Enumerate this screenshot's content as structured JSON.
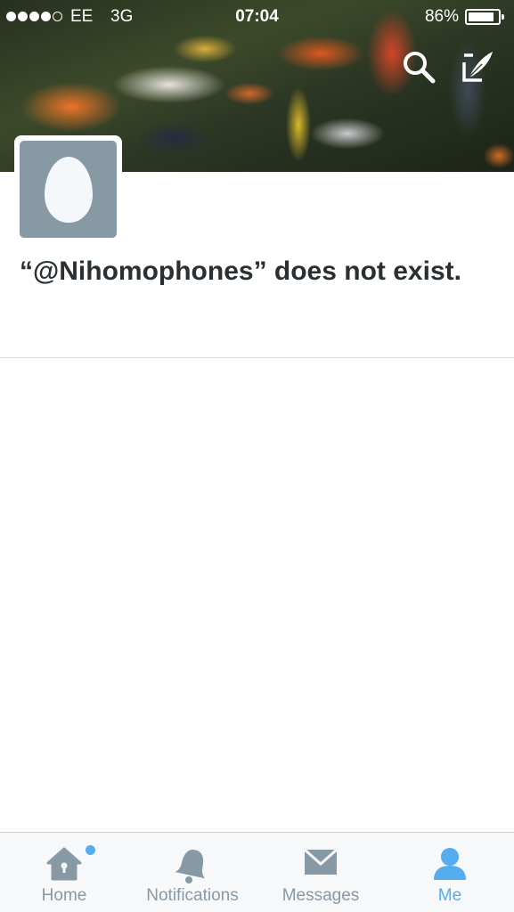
{
  "status_bar": {
    "signal_bars": 5,
    "signal_filled": 4,
    "carrier": "EE",
    "network": "3G",
    "time": "07:04",
    "battery_percent": "86%",
    "battery_level": 0.86
  },
  "header": {
    "search_icon": "search-icon",
    "compose_icon": "compose-tweet-icon"
  },
  "profile": {
    "avatar_icon": "default-egg-avatar",
    "message": "“@Nihomophones” does not exist."
  },
  "tab_bar": {
    "tabs": [
      {
        "label": "Home",
        "icon": "home-icon",
        "active": false,
        "has_unread": true
      },
      {
        "label": "Notifications",
        "icon": "bell-icon",
        "active": false
      },
      {
        "label": "Messages",
        "icon": "envelope-icon",
        "active": false
      },
      {
        "label": "Me",
        "icon": "person-icon",
        "active": true
      }
    ]
  },
  "colors": {
    "accent": "#55acee",
    "inactive_icon": "#8899a6",
    "text": "#292f33",
    "avatar_bg": "#8899a6"
  }
}
